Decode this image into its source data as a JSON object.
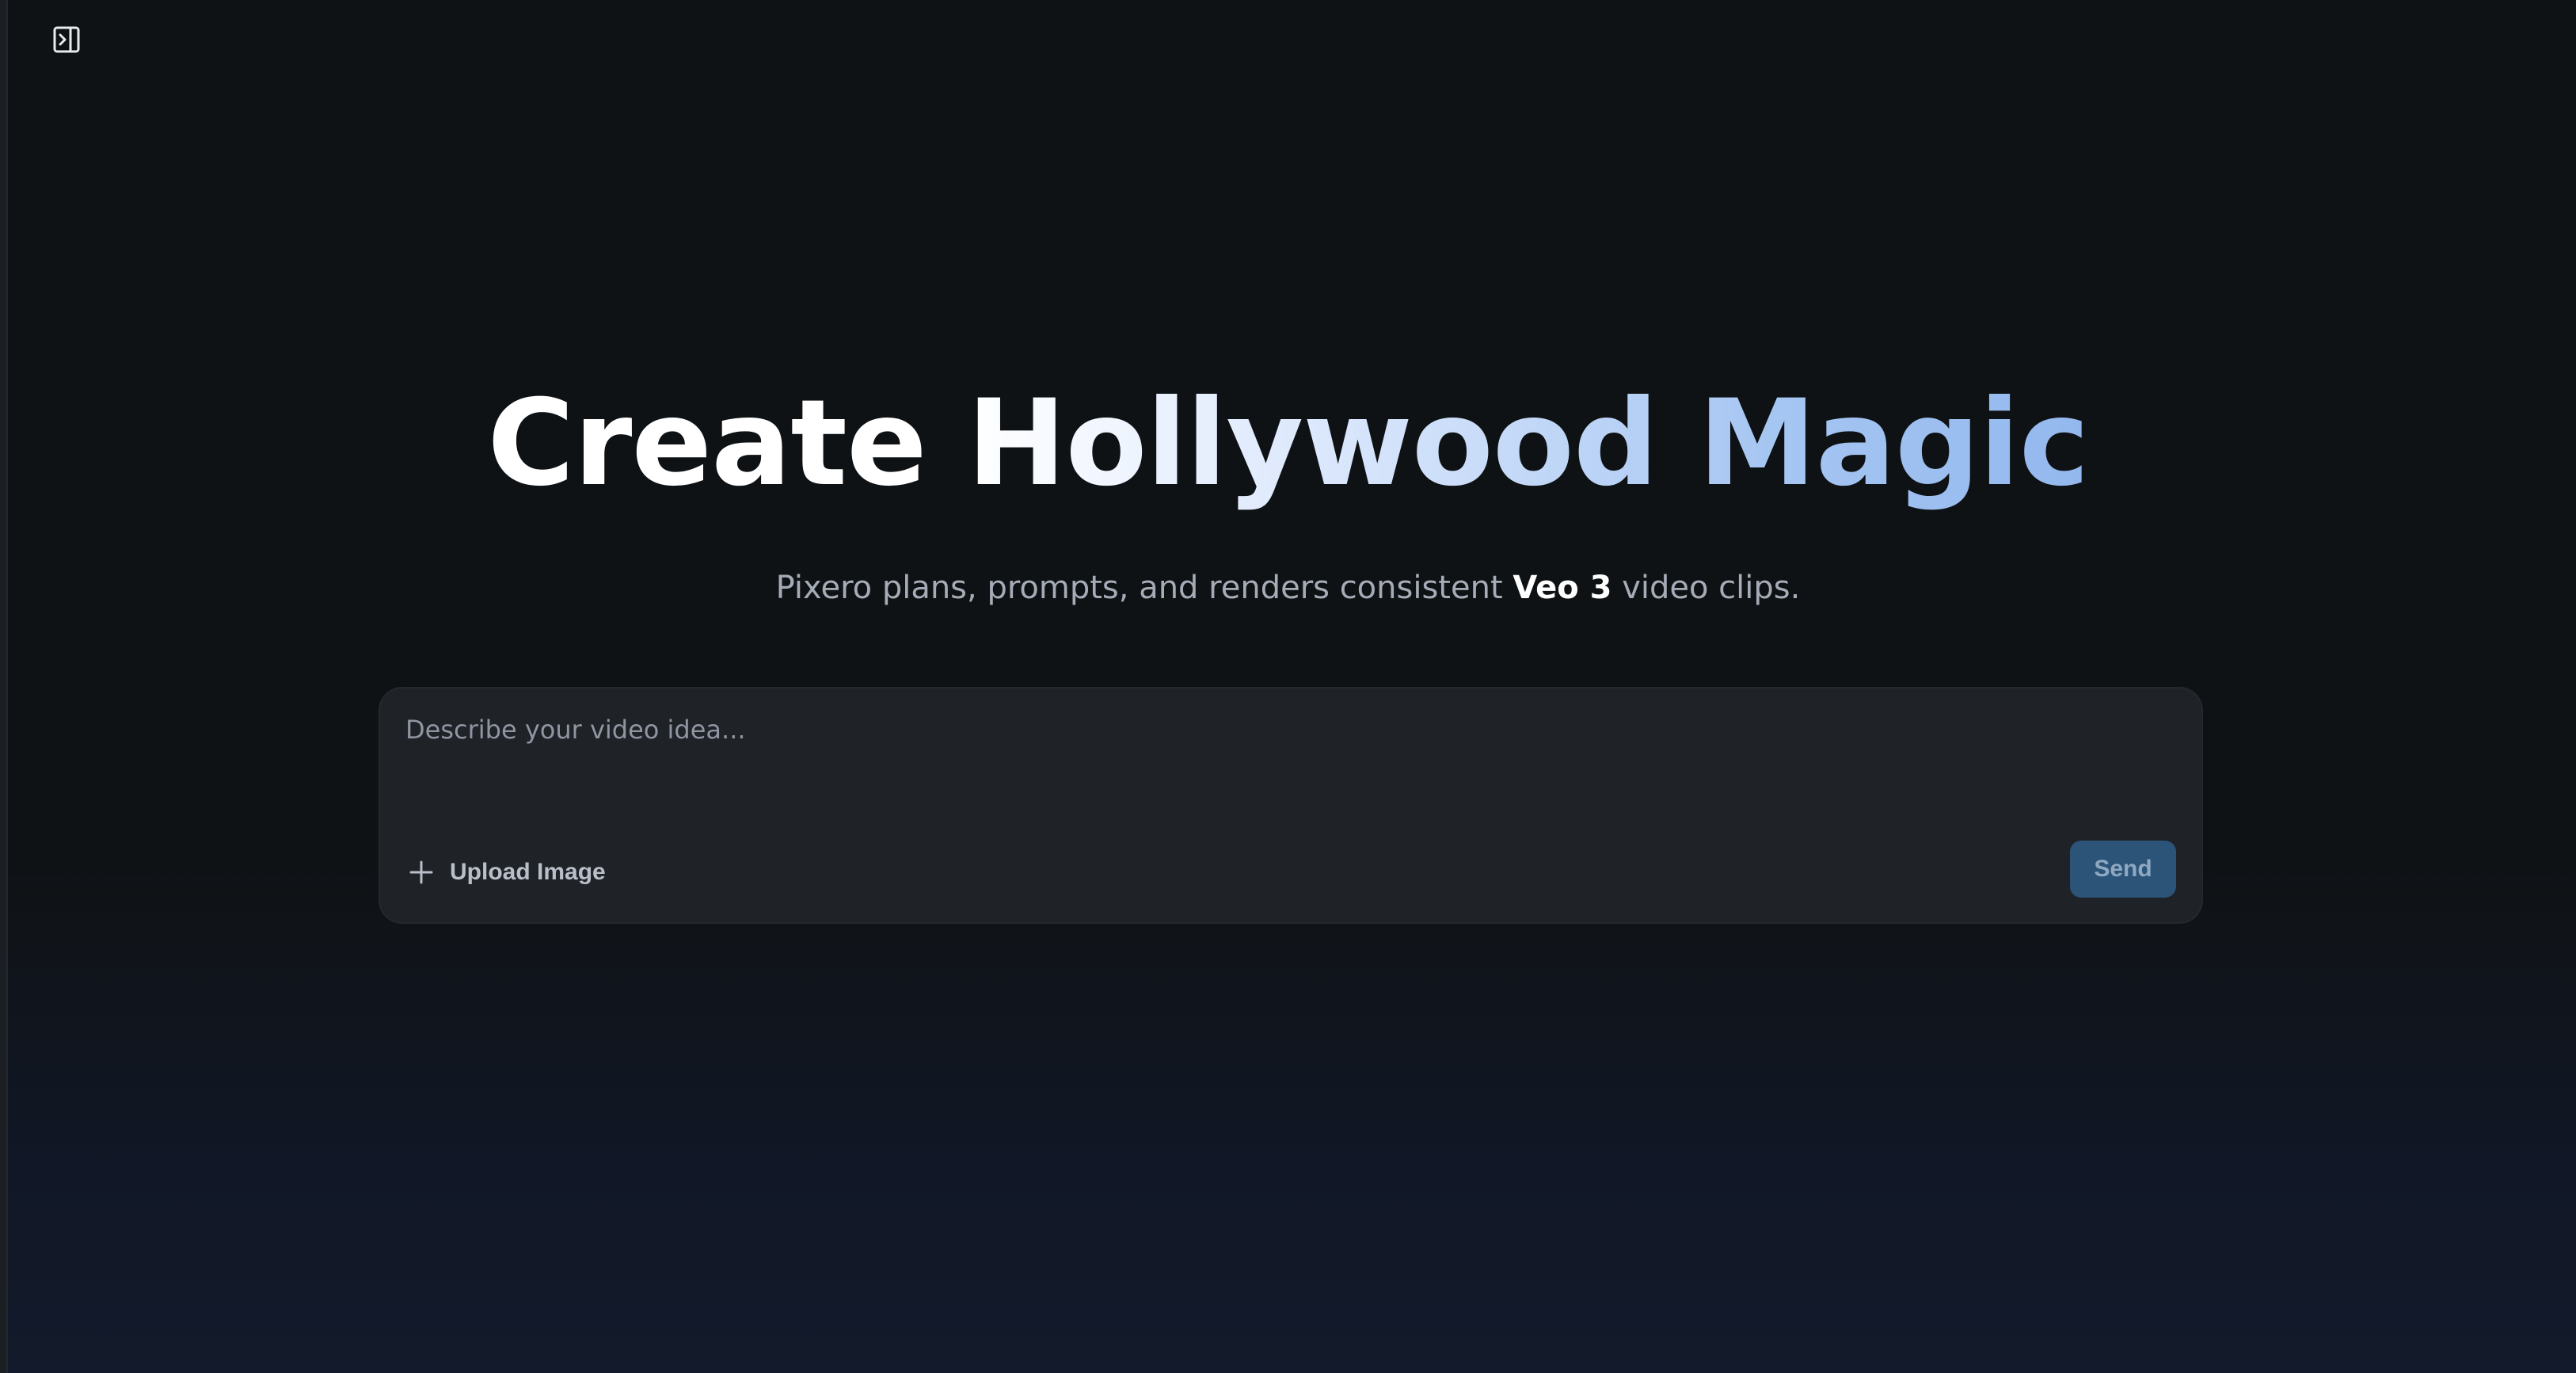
{
  "header": {
    "sidebar_toggle_icon": "sidebar-expand-icon"
  },
  "hero": {
    "title": "Create Hollywood Magic",
    "subtitle_prefix": "Pixero plans, prompts, and renders consistent ",
    "subtitle_highlight": "Veo 3",
    "subtitle_suffix": " video clips."
  },
  "composer": {
    "placeholder": "Describe your video idea...",
    "value": "",
    "upload_icon": "plus-icon",
    "upload_label": "Upload Image",
    "send_label": "Send"
  },
  "colors": {
    "background": "#0f1214",
    "composer_background": "#1f2227",
    "send_button": "#2b5478",
    "title_gradient_end": "#93b8ee",
    "subtitle_text": "#a5acb7"
  }
}
